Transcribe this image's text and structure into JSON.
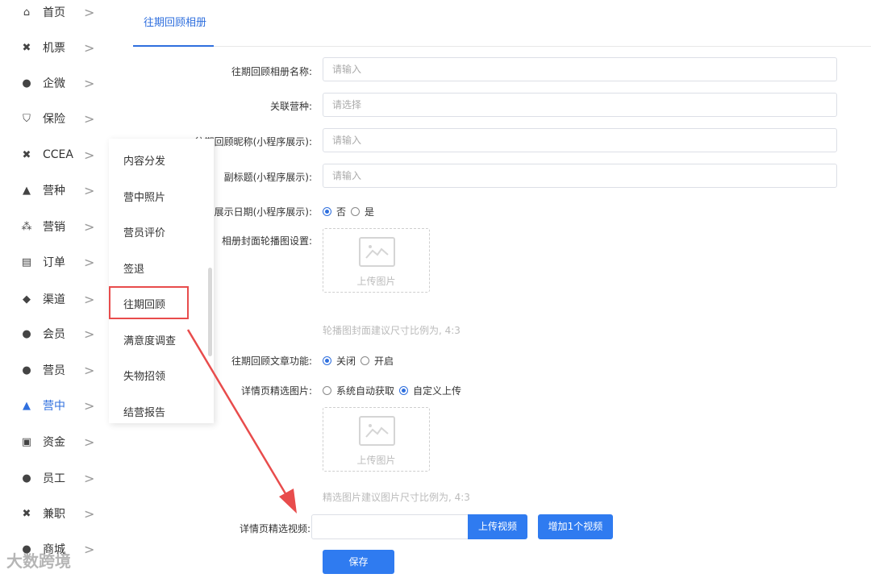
{
  "sidebar": {
    "items": [
      {
        "label": "首页",
        "icon": "home-icon",
        "glyph": "⌂"
      },
      {
        "label": "机票",
        "icon": "tools-icon",
        "glyph": "✖"
      },
      {
        "label": "企微",
        "icon": "chat-icon",
        "glyph": "●"
      },
      {
        "label": "保险",
        "icon": "shield-icon",
        "glyph": "⛉"
      },
      {
        "label": "CCEA",
        "icon": "tools-icon",
        "glyph": "✖"
      },
      {
        "label": "营种",
        "icon": "graduation-icon",
        "glyph": "▲"
      },
      {
        "label": "营销",
        "icon": "org-chart-icon",
        "glyph": "⁂"
      },
      {
        "label": "订单",
        "icon": "clipboard-icon",
        "glyph": "▤"
      },
      {
        "label": "渠道",
        "icon": "handshake-icon",
        "glyph": "◆"
      },
      {
        "label": "会员",
        "icon": "member-icon",
        "glyph": "●"
      },
      {
        "label": "营员",
        "icon": "camper-icon",
        "glyph": "●"
      },
      {
        "label": "营中",
        "icon": "tent-icon",
        "glyph": "▲"
      },
      {
        "label": "资金",
        "icon": "fund-icon",
        "glyph": "▣"
      },
      {
        "label": "员工",
        "icon": "staff-icon",
        "glyph": "●"
      },
      {
        "label": "兼职",
        "icon": "tools-icon",
        "glyph": "✖"
      },
      {
        "label": "商城",
        "icon": "shop-icon",
        "glyph": "●"
      }
    ],
    "chevron": ">"
  },
  "submenu": {
    "items": [
      "内容分发",
      "营中照片",
      "营员评价",
      "签退",
      "往期回顾",
      "满意度调查",
      "失物招领",
      "结营报告"
    ]
  },
  "tab": {
    "label": "往期回顾相册"
  },
  "form": {
    "album_name_label": "往期回顾相册名称:",
    "album_name_placeholder": "请输入",
    "camp_type_label": "关联营种:",
    "camp_type_placeholder": "请选择",
    "nickname_label": "往期回顾昵称(小程序展示):",
    "nickname_placeholder": "请输入",
    "subtitle_label": "副标题(小程序展示):",
    "subtitle_placeholder": "请输入",
    "show_date_label": "展示日期(小程序展示):",
    "show_date_no": "否",
    "show_date_yes": "是",
    "cover_label": "相册封面轮播图设置:",
    "upload_text": "上传图片",
    "cover_hint": "轮播图封面建议尺寸比例为, 4:3",
    "article_label": "往期回顾文章功能:",
    "article_off": "关闭",
    "article_on": "开启",
    "featured_image_label": "详情页精选图片:",
    "featured_auto": "系统自动获取",
    "featured_custom": "自定义上传",
    "featured_upload_text": "上传图片",
    "featured_hint": "精选图片建议图片尺寸比例为, 4:3",
    "video_label": "详情页精选视频:",
    "upload_video_button": "上传视频",
    "add_video_button": "增加1个视频",
    "save_button": "保存"
  },
  "watermark": "大数跨境",
  "colors": {
    "accent": "#2f7bf0",
    "annotation": "#e84c4c"
  }
}
